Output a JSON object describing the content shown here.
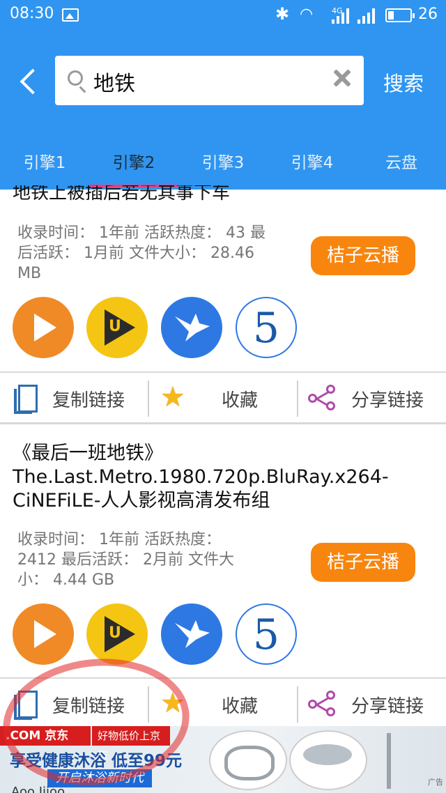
{
  "status_bar": {
    "time": "08:30",
    "network": "4G",
    "battery": "26"
  },
  "header": {
    "search_value": "地铁",
    "search_button": "搜索"
  },
  "tabs": [
    {
      "label": "引擎1"
    },
    {
      "label": "引擎2",
      "active": true
    },
    {
      "label": "引擎3"
    },
    {
      "label": "引擎4"
    },
    {
      "label": "云盘"
    }
  ],
  "results": [
    {
      "title_partial": "地铁上被插后若无其事下车",
      "meta": "收录时间： 1年前 活跃热度： 43 最后活跃： 1月前 文件大小： 28.46 MB",
      "cloud_button": "桔子云播"
    },
    {
      "title": "《最后一班地铁》The.Last.Metro.1980.720p.BluRay.x264-CiNEFiLE-人人影视高清发布组",
      "meta": "收录时间： 1年前 活跃热度： 2412 最后活跃： 2月前 文件大小： 4.44 GB",
      "cloud_button": "桔子云播"
    }
  ],
  "player_icons": [
    "orange-play-icon",
    "yellow-u-player-icon",
    "blue-bird-player-icon",
    "five-player-icon"
  ],
  "actions": {
    "copy": "复制链接",
    "fav": "收藏",
    "share": "分享链接"
  },
  "ad": {
    "brand": ".COM 京东",
    "partner": "好物低价上京东",
    "slogan": "享受健康沐浴 低至99元",
    "sub": "开启沐浴新时代",
    "tag": "广告"
  },
  "peek_text": "Aoo Jiioo"
}
